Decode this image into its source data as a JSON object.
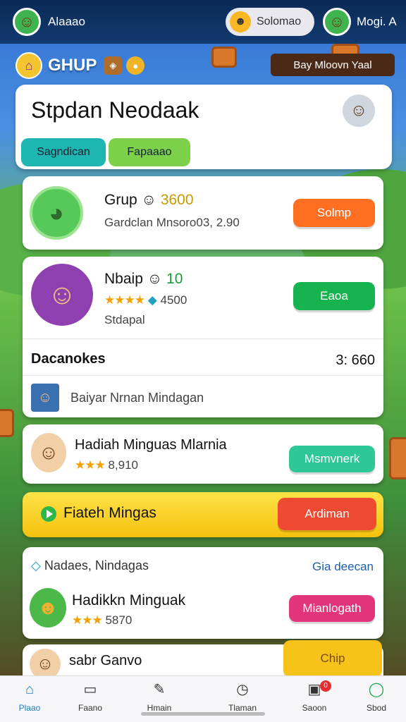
{
  "top_bar": {
    "left_name": "Alaaao",
    "coin_label": "Solomao",
    "right_name": "Mogi. A"
  },
  "group_bar": {
    "title": "GHUP",
    "pay_label": "Bay Mloovn Yaal"
  },
  "header_card": {
    "title": "Stpdan Neodaak",
    "tabs": [
      "Sagndican",
      "Fapaaao"
    ]
  },
  "rows": {
    "grup": {
      "title": "Grup",
      "score": "3600",
      "subtitle": "Gardclan Mnsoro03, 2.90",
      "button": "Solmp"
    },
    "nbaip": {
      "title": "Nbaip",
      "score": "10",
      "rating": "4500",
      "subtitle": "Stdapal",
      "button": "Eaoa"
    },
    "dacanokes": {
      "title": "Dacanokes",
      "value": "3: 660"
    },
    "bayar": {
      "label": "Baiyar Nrnan Mindagan"
    },
    "hadiah": {
      "title": "Hadiah Minguas Mlarnia",
      "score": "8,910",
      "button": "Msmvnerk"
    },
    "fiateh": {
      "title": "Fiateh Mingas",
      "button": "Ardiman"
    },
    "nadaes": {
      "title": "Nadaes, Nindagas",
      "link": "Gia deecan"
    },
    "hadikkn": {
      "title": "Hadikkn Minguak",
      "score": "5870",
      "button": "Mianlogath"
    },
    "sabr": {
      "title": "sabr Ganvo",
      "button": "Chip"
    }
  },
  "bottom_nav": [
    {
      "label": "Plaao",
      "icon": "home-icon"
    },
    {
      "label": "Faano",
      "icon": "laptop-icon"
    },
    {
      "label": "Hmain",
      "icon": "pencil-icon"
    },
    {
      "label": "Tlaman",
      "icon": "clock-icon"
    },
    {
      "label": "Saoon",
      "icon": "bag-icon",
      "badge": "0"
    },
    {
      "label": "Sbod",
      "icon": "chat-icon"
    }
  ],
  "colors": {
    "accent_orange": "#ff6e21",
    "accent_green": "#17b34e",
    "accent_teal": "#2ec796",
    "accent_pink": "#e2347a",
    "bar_yellow": "#f5c10e",
    "nav_active": "#1a7fbf"
  }
}
